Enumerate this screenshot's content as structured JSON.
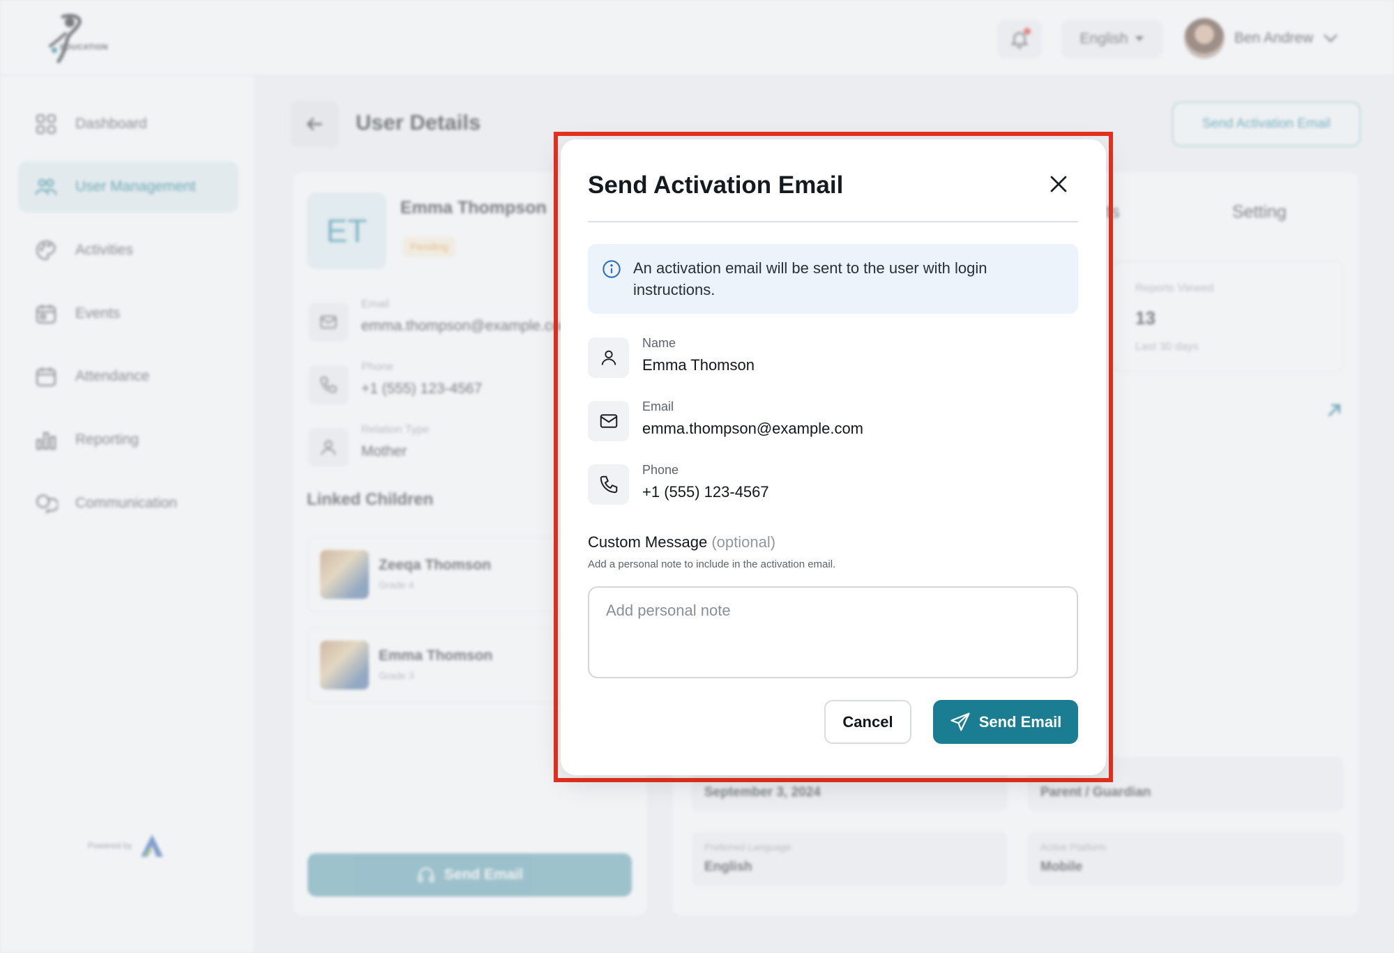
{
  "topbar": {
    "logo_text": "EDUCATION",
    "language": "English",
    "user_name": "Ben Andrew"
  },
  "sidebar": {
    "items": [
      {
        "label": "Dashboard",
        "icon": "grid-icon"
      },
      {
        "label": "User Management",
        "icon": "users-icon",
        "active": true
      },
      {
        "label": "Activities",
        "icon": "palette-icon"
      },
      {
        "label": "Events",
        "icon": "calendar-icon"
      },
      {
        "label": "Attendance",
        "icon": "calendar-check-icon"
      },
      {
        "label": "Reporting",
        "icon": "bar-chart-icon"
      },
      {
        "label": "Communication",
        "icon": "chat-icon"
      }
    ],
    "powered_by": "Powered by"
  },
  "page": {
    "title": "User Details",
    "send_activation_label": "Send Activation Email"
  },
  "profile": {
    "initials": "ET",
    "name": "Emma Thompson",
    "status": "Pending",
    "email_label": "Email",
    "email_value": "emma.thompson@example.com",
    "phone_label": "Phone",
    "phone_value": "+1 (555) 123-4567",
    "relation_label": "Relation Type",
    "relation_value": "Mother",
    "linked_children_title": "Linked Children",
    "children": [
      {
        "name": "Zeeqa Thomson",
        "grade": "Grade 4"
      },
      {
        "name": "Emma Thomson",
        "grade": "Grade 3"
      }
    ],
    "send_email_label": "Send Email"
  },
  "right_panel": {
    "tab_partial": "ts",
    "tab_setting": "Setting",
    "stat": {
      "label": "Reports Viewed",
      "value": "13",
      "sub": "Last 30 days"
    },
    "fields": [
      {
        "label": "",
        "value": "September 3, 2024"
      },
      {
        "label": "",
        "value": "Parent / Guardian"
      },
      {
        "label": "Preferred Language",
        "value": "English"
      },
      {
        "label": "Active Platform",
        "value": "Mobile"
      }
    ]
  },
  "modal": {
    "title": "Send Activation Email",
    "info": "An activation email will be sent to the user with login instructions.",
    "name_label": "Name",
    "name_value": "Emma Thomson",
    "email_label": "Email",
    "email_value": "emma.thompson@example.com",
    "phone_label": "Phone",
    "phone_value": "+1 (555) 123-4567",
    "custom_message_label": "Custom Message",
    "custom_message_optional": "(optional)",
    "custom_message_help": "Add a personal note to include in the activation email.",
    "note_placeholder": "Add personal note",
    "note_value": "",
    "cancel_label": "Cancel",
    "send_label": "Send Email"
  },
  "colors": {
    "accent": "#1a7d92",
    "highlight_border": "#e5311f",
    "info_bg": "#edf3fb",
    "pending": "#e6a74a"
  }
}
